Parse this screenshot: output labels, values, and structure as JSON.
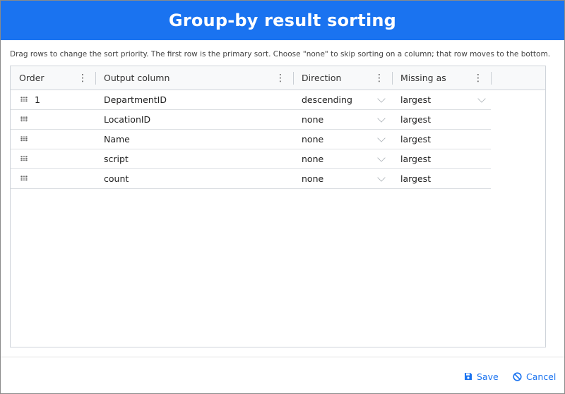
{
  "dialog": {
    "title": "Group-by result sorting",
    "instructions": "Drag rows to change the sort priority. The first row is the primary sort. Choose \"none\" to skip sorting on a column; that row moves to the bottom."
  },
  "grid": {
    "columns": [
      {
        "label": "Order"
      },
      {
        "label": "Output column"
      },
      {
        "label": "Direction"
      },
      {
        "label": "Missing as"
      }
    ],
    "rows": [
      {
        "order": "1",
        "column": "DepartmentID",
        "direction": "descending",
        "missing": "largest"
      },
      {
        "order": "",
        "column": "LocationID",
        "direction": "none",
        "missing": "largest"
      },
      {
        "order": "",
        "column": "Name",
        "direction": "none",
        "missing": "largest"
      },
      {
        "order": "",
        "column": "script",
        "direction": "none",
        "missing": "largest"
      },
      {
        "order": "",
        "column": "count",
        "direction": "none",
        "missing": "largest"
      }
    ]
  },
  "footer": {
    "save_label": "Save",
    "cancel_label": "Cancel"
  },
  "colors": {
    "accent": "#1a73f0",
    "titlebar_text": "#ffffff"
  },
  "icons": {
    "header_menu": "kebab-icon",
    "row_handle": "drag-handle-icon",
    "dropdown": "chevron-down-icon",
    "save": "floppy-disk-icon",
    "cancel": "ban-icon"
  }
}
